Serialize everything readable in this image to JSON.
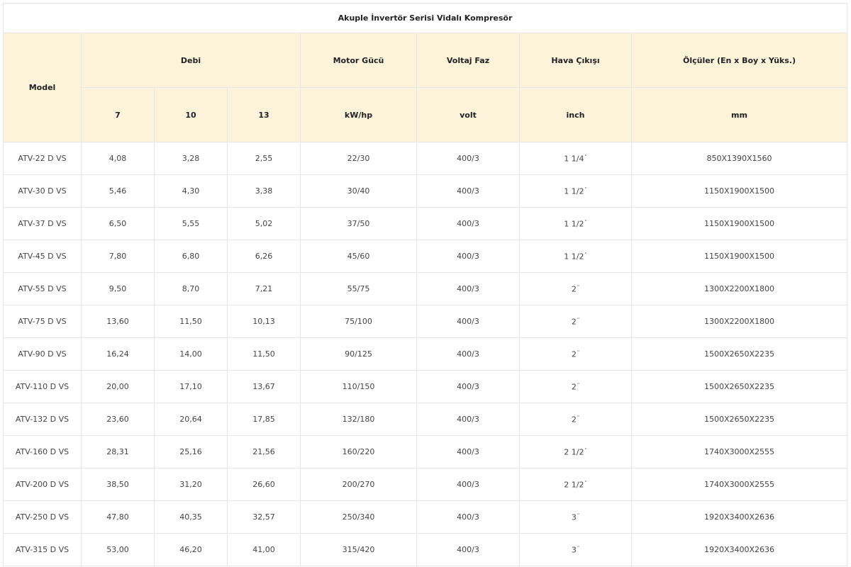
{
  "title": "Akuple İnvertör Serisi Vidalı Kompresör",
  "headers": {
    "model": "Model",
    "debi": "Debi",
    "motor": "Motor Gücü",
    "voltaj": "Voltaj Faz",
    "hava": "Hava Çıkışı",
    "olculer": "Ölçüler (En x Boy x Yüks.)"
  },
  "subheaders": {
    "debi_7": "7",
    "debi_10": "10",
    "debi_13": "13",
    "motor_unit": "kW/hp",
    "voltaj_unit": "volt",
    "hava_unit": "inch",
    "olculer_unit": "mm"
  },
  "rows": [
    {
      "model": "ATV-22 D VS",
      "d7": "4,08",
      "d10": "3,28",
      "d13": "2,55",
      "motor": "22/30",
      "voltaj": "400/3",
      "hava": "1 1/4",
      "hava_mark": "\"",
      "olcu": "850X1390X1560"
    },
    {
      "model": "ATV-30 D VS",
      "d7": "5,46",
      "d10": "4,30",
      "d13": "3,38",
      "motor": "30/40",
      "voltaj": "400/3",
      "hava": "1 1/2",
      "hava_mark": "\"",
      "olcu": "1150X1900X1500"
    },
    {
      "model": "ATV-37 D VS",
      "d7": "6,50",
      "d10": "5,55",
      "d13": "5,02",
      "motor": "37/50",
      "voltaj": "400/3",
      "hava": "1 1/2",
      "hava_mark": "\"",
      "olcu": "1150X1900X1500"
    },
    {
      "model": "ATV-45 D VS",
      "d7": "7,80",
      "d10": "6,80",
      "d13": "6,26",
      "motor": "45/60",
      "voltaj": "400/3",
      "hava": "1 1/2",
      "hava_mark": "\"",
      "olcu": "1150X1900X1500"
    },
    {
      "model": "ATV-55 D VS",
      "d7": "9,50",
      "d10": "8,70",
      "d13": "7,21",
      "motor": "55/75",
      "voltaj": "400/3",
      "hava": "2",
      "hava_mark": "\"",
      "olcu": "1300X2200X1800"
    },
    {
      "model": "ATV-75 D VS",
      "d7": "13,60",
      "d10": "11,50",
      "d13": "10,13",
      "motor": "75/100",
      "voltaj": "400/3",
      "hava": "2",
      "hava_mark": "\"",
      "olcu": "1300X2200X1800"
    },
    {
      "model": "ATV-90 D VS",
      "d7": "16,24",
      "d10": "14,00",
      "d13": "11,50",
      "motor": "90/125",
      "voltaj": "400/3",
      "hava": "2",
      "hava_mark": "\"",
      "olcu": "1500X2650X2235"
    },
    {
      "model": "ATV-110 D VS",
      "d7": "20,00",
      "d10": "17,10",
      "d13": "13,67",
      "motor": "110/150",
      "voltaj": "400/3",
      "hava": "2",
      "hava_mark": "\"",
      "olcu": "1500X2650X2235"
    },
    {
      "model": "ATV-132 D VS",
      "d7": "23,60",
      "d10": "20,64",
      "d13": "17,85",
      "motor": "132/180",
      "voltaj": "400/3",
      "hava": "2",
      "hava_mark": "\"",
      "olcu": "1500X2650X2235"
    },
    {
      "model": "ATV-160 D VS",
      "d7": "28,31",
      "d10": "25,16",
      "d13": "21,56",
      "motor": "160/220",
      "voltaj": "400/3",
      "hava": "2 1/2",
      "hava_mark": "\"",
      "olcu": "1740X3000X2555"
    },
    {
      "model": "ATV-200 D VS",
      "d7": "38,50",
      "d10": "31,20",
      "d13": "26,60",
      "motor": "200/270",
      "voltaj": "400/3",
      "hava": "2 1/2",
      "hava_mark": "\"",
      "olcu": "1740X3000X2555"
    },
    {
      "model": "ATV-250 D VS",
      "d7": "47,80",
      "d10": "40,35",
      "d13": "32,57",
      "motor": "250/340",
      "voltaj": "400/3",
      "hava": "3",
      "hava_mark": "\"",
      "olcu": "1920X3400X2636"
    },
    {
      "model": "ATV-315 D VS",
      "d7": "53,00",
      "d10": "46,20",
      "d13": "41,00",
      "motor": "315/420",
      "voltaj": "400/3",
      "hava": "3",
      "hava_mark": "\"",
      "olcu": "1920X3400X2636"
    }
  ]
}
